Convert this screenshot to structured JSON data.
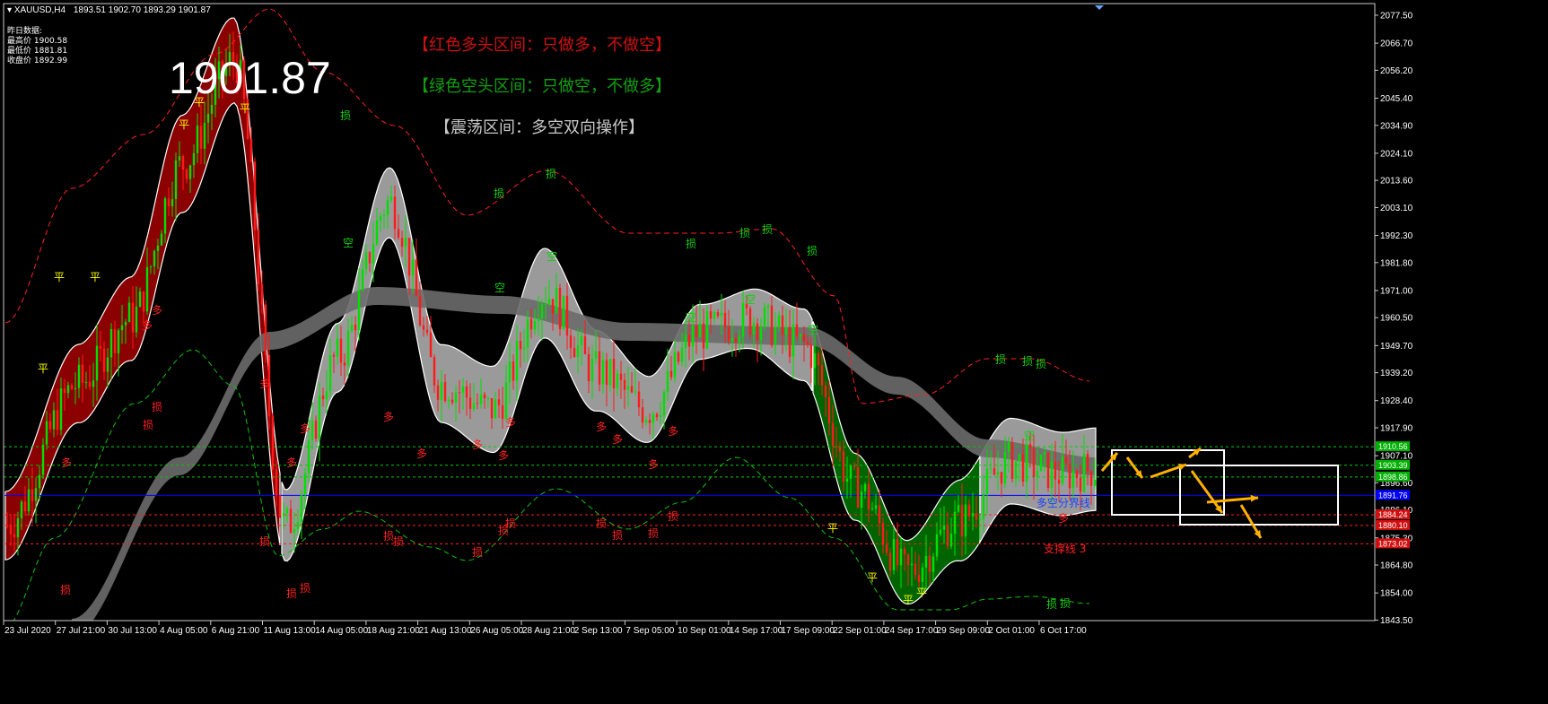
{
  "header": {
    "symbol": "XAUUSD,H4",
    "ohlc": "1893.51 1902.70 1893.29 1901.87"
  },
  "stats": {
    "title": "昨日数据:",
    "high": "最高价 1900.58",
    "low": "最低价 1881.81",
    "close": "收盘价 1892.99"
  },
  "current_price": "1901.87",
  "notices": {
    "red": "【红色多头区间：只做多，不做空】",
    "green": "【绿色空头区间：只做空，不做多】",
    "gray": "【震荡区间：多空双向操作】"
  },
  "colors": {
    "background": "#000000",
    "bull_zone": "#8b0000",
    "bear_zone": "#006400",
    "range_zone": "#9a9a9a",
    "bull_candle": "#00e000",
    "bear_candle": "#ff1a1a",
    "divider_line": "#0000ff",
    "arrows": "#ffb000"
  },
  "chart_data": {
    "type": "candlestick",
    "symbol": "XAUUSD",
    "timeframe": "H4",
    "ylim": [
      1843.3,
      2082.0
    ],
    "y_ticks": [
      "2077.50",
      "2066.70",
      "2056.20",
      "2045.40",
      "2034.90",
      "2024.10",
      "2013.60",
      "2003.10",
      "1992.30",
      "1981.80",
      "1971.00",
      "1960.50",
      "1949.70",
      "1939.20",
      "1928.40",
      "1917.90",
      "1907.10",
      "1896.60",
      "1886.10",
      "1875.30",
      "1864.80",
      "1854.00",
      "1843.50"
    ],
    "x_ticks": [
      "23 Jul 2020",
      "27 Jul 21:00",
      "30 Jul 13:00",
      "4 Aug 05:00",
      "6 Aug 21:00",
      "11 Aug 13:00",
      "14 Aug 05:00",
      "18 Aug 21:00",
      "21 Aug 13:00",
      "26 Aug 05:00",
      "28 Aug 21:00",
      "2 Sep 13:00",
      "7 Sep 05:00",
      "10 Sep 01:00",
      "14 Sep 17:00",
      "17 Sep 09:00",
      "22 Sep 01:00",
      "24 Sep 17:00",
      "29 Sep 09:00",
      "2 Oct 01:00",
      "6 Oct 17:00"
    ],
    "close_path": [
      [
        "23 Jul 2020",
        1880
      ],
      [
        "27 Jul 21:00",
        1935
      ],
      [
        "30 Jul 13:00",
        1960
      ],
      [
        "4 Aug 05:00",
        2020
      ],
      [
        "6 Aug 21:00",
        2060
      ],
      [
        "11 Aug 13:00",
        1880
      ],
      [
        "14 Aug 05:00",
        1945
      ],
      [
        "18 Aug 21:00",
        2005
      ],
      [
        "21 Aug 13:00",
        1935
      ],
      [
        "26 Aug 05:00",
        1925
      ],
      [
        "28 Aug 21:00",
        1970
      ],
      [
        "2 Sep 13:00",
        1940
      ],
      [
        "7 Sep 05:00",
        1925
      ],
      [
        "10 Sep 01:00",
        1955
      ],
      [
        "14 Sep 17:00",
        1960
      ],
      [
        "17 Sep 09:00",
        1950
      ],
      [
        "22 Sep 01:00",
        1895
      ],
      [
        "24 Sep 17:00",
        1862
      ],
      [
        "29 Sep 09:00",
        1882
      ],
      [
        "2 Oct 01:00",
        1905
      ],
      [
        "6 Oct 17:00",
        1900
      ],
      [
        "last",
        1901.87
      ]
    ],
    "horizontal_levels": [
      {
        "price": "1910.56",
        "color": "#00cc00",
        "style": "dashed"
      },
      {
        "price": "1903.39",
        "color": "#00cc00",
        "style": "dashed"
      },
      {
        "price": "1898.86",
        "color": "#00cc00",
        "style": "dashed"
      },
      {
        "price": "1891.76",
        "color": "#0000ff",
        "style": "solid"
      },
      {
        "price": "1884.24",
        "color": "#ff2020",
        "style": "dashed"
      },
      {
        "price": "1880.10",
        "color": "#ff2020",
        "style": "dashed"
      },
      {
        "price": "1873.02",
        "color": "#ff2020",
        "style": "dashed"
      }
    ],
    "labels": {
      "divider": "多空分界线",
      "support": "支撑线 3",
      "flat": "平",
      "short": "空",
      "long": "多",
      "stop": "损"
    },
    "grid": false
  }
}
